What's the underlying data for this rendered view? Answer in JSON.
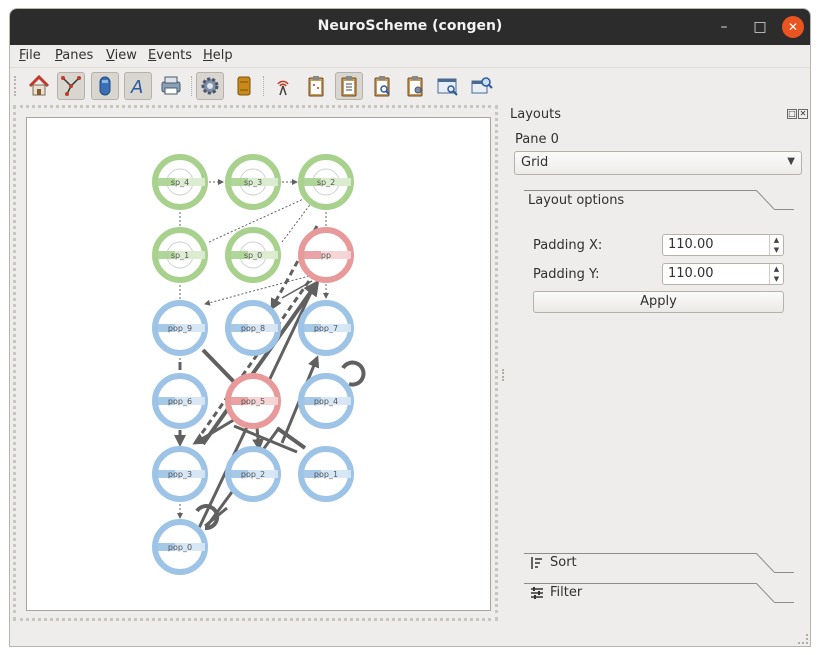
{
  "window": {
    "title": "NeuroScheme (congen)"
  },
  "menu": [
    {
      "underline": "F",
      "rest": "ile"
    },
    {
      "underline": "P",
      "rest": "anes"
    },
    {
      "underline": "V",
      "rest": "iew"
    },
    {
      "underline": "E",
      "rest": "vents"
    },
    {
      "underline": "H",
      "rest": "elp"
    }
  ],
  "toolbar": {
    "buttons": [
      "home-icon",
      "connectivity-icon",
      "column-icon",
      "text-icon",
      "printer-icon",
      "settings-gear-icon",
      "database-icon",
      "radio-signal-icon",
      "clipboard-icon",
      "clipboard-layout-icon",
      "clipboard-search-icon",
      "clipboard-settings-icon",
      "window-search-icon",
      "window-zoom-icon"
    ]
  },
  "scene": {
    "nodes": [
      {
        "id": "sp_4",
        "label": "sp_4",
        "kind": "sp"
      },
      {
        "id": "sp_3",
        "label": "sp_3",
        "kind": "sp"
      },
      {
        "id": "sp_2",
        "label": "sp_2",
        "kind": "sp"
      },
      {
        "id": "sp_1",
        "label": "sp_1",
        "kind": "sp"
      },
      {
        "id": "sp_0",
        "label": "sp_0",
        "kind": "sp"
      },
      {
        "id": "pp",
        "label": "pp",
        "kind": "pp"
      },
      {
        "id": "pop_9",
        "label": "pop_9",
        "kind": "pop"
      },
      {
        "id": "pop_8",
        "label": "pop_8",
        "kind": "pop"
      },
      {
        "id": "pop_7",
        "label": "pop_7",
        "kind": "pop"
      },
      {
        "id": "pop_6",
        "label": "pop_6",
        "kind": "pop"
      },
      {
        "id": "pop_5",
        "label": "pop_5",
        "kind": "pop5"
      },
      {
        "id": "pop_4",
        "label": "pop_4",
        "kind": "pop"
      },
      {
        "id": "pop_3",
        "label": "pop_3",
        "kind": "pop"
      },
      {
        "id": "pop_2",
        "label": "pop_2",
        "kind": "pop"
      },
      {
        "id": "pop_1",
        "label": "pop_1",
        "kind": "pop"
      },
      {
        "id": "pop_0",
        "label": "pop_0",
        "kind": "pop"
      }
    ],
    "colors": {
      "sp": "#a9d18e",
      "pp": "#e8999a",
      "pop": "#9dc3e6",
      "pop5": "#e8999a",
      "edge": "#606060"
    }
  },
  "dock": {
    "title": "Layouts",
    "pane_label": "Pane 0",
    "layout_select": "Grid",
    "layout_options_label": "Layout options",
    "padding_x_label": "Padding X:",
    "padding_x_value": "110.00",
    "padding_y_label": "Padding Y:",
    "padding_y_value": "110.00",
    "apply_label": "Apply",
    "sort_label": "Sort",
    "filter_label": "Filter"
  }
}
